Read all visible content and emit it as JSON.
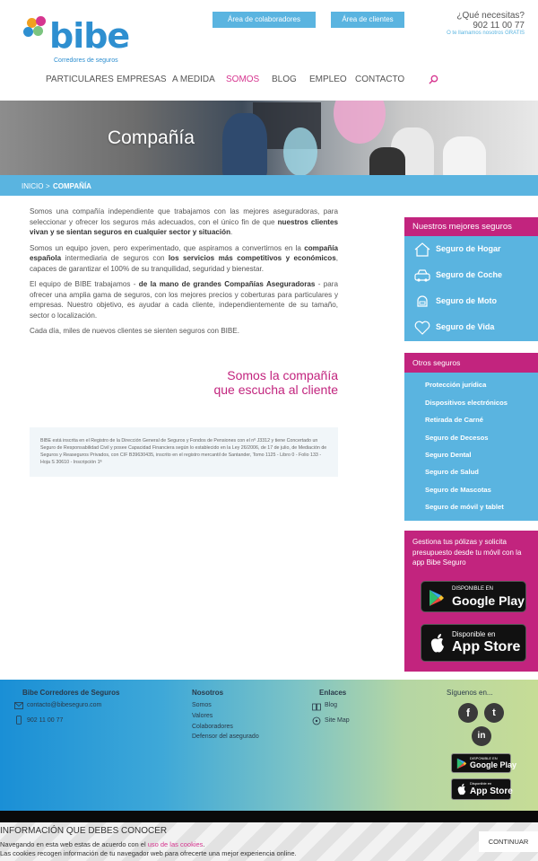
{
  "colors": {
    "accent": "#5ab4e0",
    "brand_pink": "#c2247e",
    "nav_active": "#d6358f"
  },
  "header": {
    "logo_word": "bibe",
    "logo_sub": "Corredores de seguros",
    "btn_collab": "Área de colaboradores",
    "btn_clients": "Área de clientes",
    "question": "¿Qué necesitas?",
    "phone": "902 11 00 77",
    "free_call": "O te llamamos nosotros GRATIS",
    "nav": [
      "PARTICULARES",
      "EMPRESAS",
      "A MEDIDA",
      "SOMOS",
      "BLOG",
      "EMPLEO",
      "CONTACTO"
    ],
    "nav_active": "SOMOS"
  },
  "hero": {
    "title": "Compañía"
  },
  "breadcrumb": {
    "home": "INICIO",
    "separator": ">",
    "current": "COMPAÑÍA"
  },
  "content": {
    "p1_a": "Somos una compañía independiente que trabajamos con las mejores aseguradoras, para seleccionar y ofrecer los seguros más adecuados, con el único fin de que ",
    "p1_b": "nuestros clientes vivan y se sientan seguros en cualquier sector y situación",
    "p1_c": ".",
    "p2_a": "Somos un equipo joven, pero experimentado, que aspiramos a convertirnos en la ",
    "p2_b": "compañía española",
    "p2_c": " intermediaria de seguros con ",
    "p2_d": "los servicios más competitivos y económicos",
    "p2_e": ", capaces de garantizar el 100% de su tranquilidad, seguridad y bienestar.",
    "p3_a": "El equipo de BIBE trabajamos - ",
    "p3_b": "de la mano de grandes Compañías Aseguradoras",
    "p3_c": " - para ofrecer una amplia gama de seguros, con los mejores precios y coberturas para particulares y empresas. Nuestro objetivo, es ayudar a cada cliente, independientemente de su tamaño, sector o localización.",
    "p4": "Cada día, miles de nuevos clientes se sienten seguros con BIBE.",
    "slogan_1": "Somos la compañía",
    "slogan_2": "que escucha al cliente",
    "legal": "BIBE está inscrita en el Registro de la Dirección General de Seguros y Fondos de Pensiones con el nº J3312 y tiene Concertado un Seguro de Responsabilidad Civil y posee Capacidad Financiera según lo establecido en la Ley 26/2006, de 17 de julio, de Mediación de Seguros y Reaseguros Privados, con CIF B39630435, inscrito en el registro mercantil de Santander, Tomo 1125 - Libro 0 - Folio 133 - Hoja S 30610 - Inscripción 1ª"
  },
  "sidebar": {
    "best_title": "Nuestros mejores seguros",
    "best": [
      {
        "label": "Seguro de Hogar",
        "icon": "home-icon"
      },
      {
        "label": "Seguro de Coche",
        "icon": "car-icon"
      },
      {
        "label": "Seguro de Moto",
        "icon": "helmet-icon"
      },
      {
        "label": "Seguro de Vida",
        "icon": "heart-icon"
      }
    ],
    "other_title": "Otros seguros",
    "other": [
      "Protección jurídica",
      "Dispositivos electrónicos",
      "Retirada de Carné",
      "Seguro de Decesos",
      "Seguro Dental",
      "Seguro de Salud",
      "Seguro de Mascotas",
      "Seguro de móvil y tablet"
    ],
    "app_text": "Gestiona tus pólizas y solicita presupuesto desde tu móvil con la app Bibe Seguro",
    "google_small": "DISPONIBLE EN",
    "google_big": "Google Play",
    "apple_small": "Disponible en",
    "apple_big": "App Store"
  },
  "footer": {
    "col1_title": "Bibe Corredores de Seguros",
    "email": "contacto@bibeseguro.com",
    "phone": "902 11 00 77",
    "col2_title": "Nosotros",
    "col2_links": [
      "Somos",
      "Valores",
      "Colaboradores",
      "Defensor del asegurado"
    ],
    "col3_title": "Enlaces",
    "col3_links": [
      "Blog",
      "Site Map"
    ],
    "col4_title": "Síguenos en...",
    "social": [
      "f",
      "t",
      "in"
    ],
    "google_small": "DISPONIBLE EN",
    "google_big": "Google Play",
    "apple_small": "Disponible en",
    "apple_big": "App Store"
  },
  "cookie": {
    "title": "INFORMACIÓN QUE DEBES CONOCER",
    "line1_a": "Navegando en esta web estas de acuerdo con el ",
    "line1_link": "uso de las cookies",
    "line1_b": ".",
    "line2": "Las cookies recogen información de tu navegador web para ofrecerte una mejor experiencia online.",
    "button": "CONTINUAR"
  }
}
